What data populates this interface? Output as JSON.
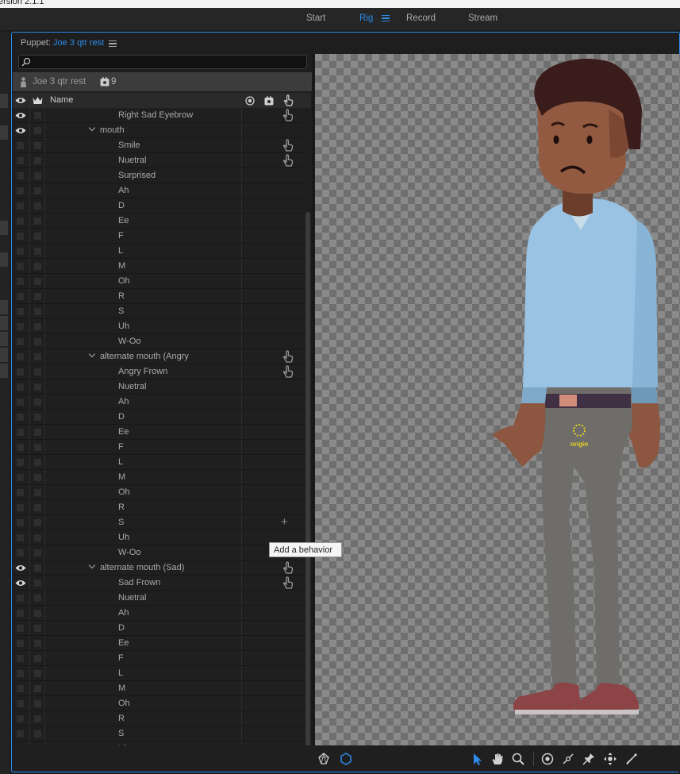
{
  "app": {
    "version_text": "ersion 2.1.1"
  },
  "modes": [
    {
      "label": "Start",
      "active": false
    },
    {
      "label": "Rig",
      "active": true
    },
    {
      "label": "Record",
      "active": false
    },
    {
      "label": "Stream",
      "active": false
    }
  ],
  "panel": {
    "title_prefix": "Puppet:",
    "puppet_name": "Joe 3 qtr rest",
    "search_placeholder": "",
    "puppet_label": "Joe 3 qtr rest",
    "handle_count": "9",
    "column_name": "Name"
  },
  "layers": [
    {
      "label": "Right Sad Eyebrow",
      "depth": 2,
      "eye": true,
      "group": false,
      "behavior": true
    },
    {
      "label": "mouth",
      "depth": 1,
      "eye": true,
      "group": true,
      "behavior": false
    },
    {
      "label": "Smile",
      "depth": 2,
      "eye": false,
      "group": false,
      "behavior": true
    },
    {
      "label": "Nuetral",
      "depth": 2,
      "eye": false,
      "group": false,
      "behavior": true
    },
    {
      "label": "Surprised",
      "depth": 2,
      "eye": false,
      "group": false,
      "behavior": false
    },
    {
      "label": "Ah",
      "depth": 2,
      "eye": false,
      "group": false,
      "behavior": false
    },
    {
      "label": "D",
      "depth": 2,
      "eye": false,
      "group": false,
      "behavior": false
    },
    {
      "label": "Ee",
      "depth": 2,
      "eye": false,
      "group": false,
      "behavior": false
    },
    {
      "label": "F",
      "depth": 2,
      "eye": false,
      "group": false,
      "behavior": false
    },
    {
      "label": "L",
      "depth": 2,
      "eye": false,
      "group": false,
      "behavior": false
    },
    {
      "label": "M",
      "depth": 2,
      "eye": false,
      "group": false,
      "behavior": false
    },
    {
      "label": "Oh",
      "depth": 2,
      "eye": false,
      "group": false,
      "behavior": false
    },
    {
      "label": "R",
      "depth": 2,
      "eye": false,
      "group": false,
      "behavior": false
    },
    {
      "label": "S",
      "depth": 2,
      "eye": false,
      "group": false,
      "behavior": false
    },
    {
      "label": "Uh",
      "depth": 2,
      "eye": false,
      "group": false,
      "behavior": false
    },
    {
      "label": "W-Oo",
      "depth": 2,
      "eye": false,
      "group": false,
      "behavior": false
    },
    {
      "label": "alternate mouth (Angry",
      "depth": 1,
      "eye": false,
      "group": true,
      "behavior": true
    },
    {
      "label": "Angry Frown",
      "depth": 2,
      "eye": false,
      "group": false,
      "behavior": true
    },
    {
      "label": "Nuetral",
      "depth": 2,
      "eye": false,
      "group": false,
      "behavior": false
    },
    {
      "label": "Ah",
      "depth": 2,
      "eye": false,
      "group": false,
      "behavior": false
    },
    {
      "label": "D",
      "depth": 2,
      "eye": false,
      "group": false,
      "behavior": false
    },
    {
      "label": "Ee",
      "depth": 2,
      "eye": false,
      "group": false,
      "behavior": false
    },
    {
      "label": "F",
      "depth": 2,
      "eye": false,
      "group": false,
      "behavior": false
    },
    {
      "label": "L",
      "depth": 2,
      "eye": false,
      "group": false,
      "behavior": false
    },
    {
      "label": "M",
      "depth": 2,
      "eye": false,
      "group": false,
      "behavior": false
    },
    {
      "label": "Oh",
      "depth": 2,
      "eye": false,
      "group": false,
      "behavior": false
    },
    {
      "label": "R",
      "depth": 2,
      "eye": false,
      "group": false,
      "behavior": false
    },
    {
      "label": "S",
      "depth": 2,
      "eye": false,
      "group": false,
      "behavior": false,
      "add": true
    },
    {
      "label": "Uh",
      "depth": 2,
      "eye": false,
      "group": false,
      "behavior": false
    },
    {
      "label": "W-Oo",
      "depth": 2,
      "eye": false,
      "group": false,
      "behavior": false
    },
    {
      "label": "alternate mouth (Sad)",
      "depth": 1,
      "eye": true,
      "group": true,
      "behavior": true
    },
    {
      "label": "Sad Frown",
      "depth": 2,
      "eye": true,
      "group": false,
      "behavior": true
    },
    {
      "label": "Nuetral",
      "depth": 2,
      "eye": false,
      "group": false,
      "behavior": false
    },
    {
      "label": "Ah",
      "depth": 2,
      "eye": false,
      "group": false,
      "behavior": false
    },
    {
      "label": "D",
      "depth": 2,
      "eye": false,
      "group": false,
      "behavior": false
    },
    {
      "label": "Ee",
      "depth": 2,
      "eye": false,
      "group": false,
      "behavior": false
    },
    {
      "label": "F",
      "depth": 2,
      "eye": false,
      "group": false,
      "behavior": false
    },
    {
      "label": "L",
      "depth": 2,
      "eye": false,
      "group": false,
      "behavior": false
    },
    {
      "label": "M",
      "depth": 2,
      "eye": false,
      "group": false,
      "behavior": false
    },
    {
      "label": "Oh",
      "depth": 2,
      "eye": false,
      "group": false,
      "behavior": false
    },
    {
      "label": "R",
      "depth": 2,
      "eye": false,
      "group": false,
      "behavior": false
    },
    {
      "label": "S",
      "depth": 2,
      "eye": false,
      "group": false,
      "behavior": false
    },
    {
      "label": "Uh",
      "depth": 2,
      "eye": false,
      "group": false,
      "behavior": false
    }
  ],
  "tooltip": "Add a behavior",
  "canvas": {
    "origin_label": "origin"
  },
  "tools_left": [
    "warp-tool-icon",
    "mesh-tool-icon"
  ],
  "tools_right": [
    "select-arrow-icon",
    "hand-pan-icon",
    "zoom-icon",
    "origin-tool-icon",
    "stick-tool-icon",
    "pin-tool-icon",
    "dragger-tool-icon",
    "bone-tool-icon"
  ],
  "colors": {
    "accent": "#2d8ceb",
    "panel_bg": "#1e1e1e",
    "tooltip_bg": "#f5f5f5"
  }
}
